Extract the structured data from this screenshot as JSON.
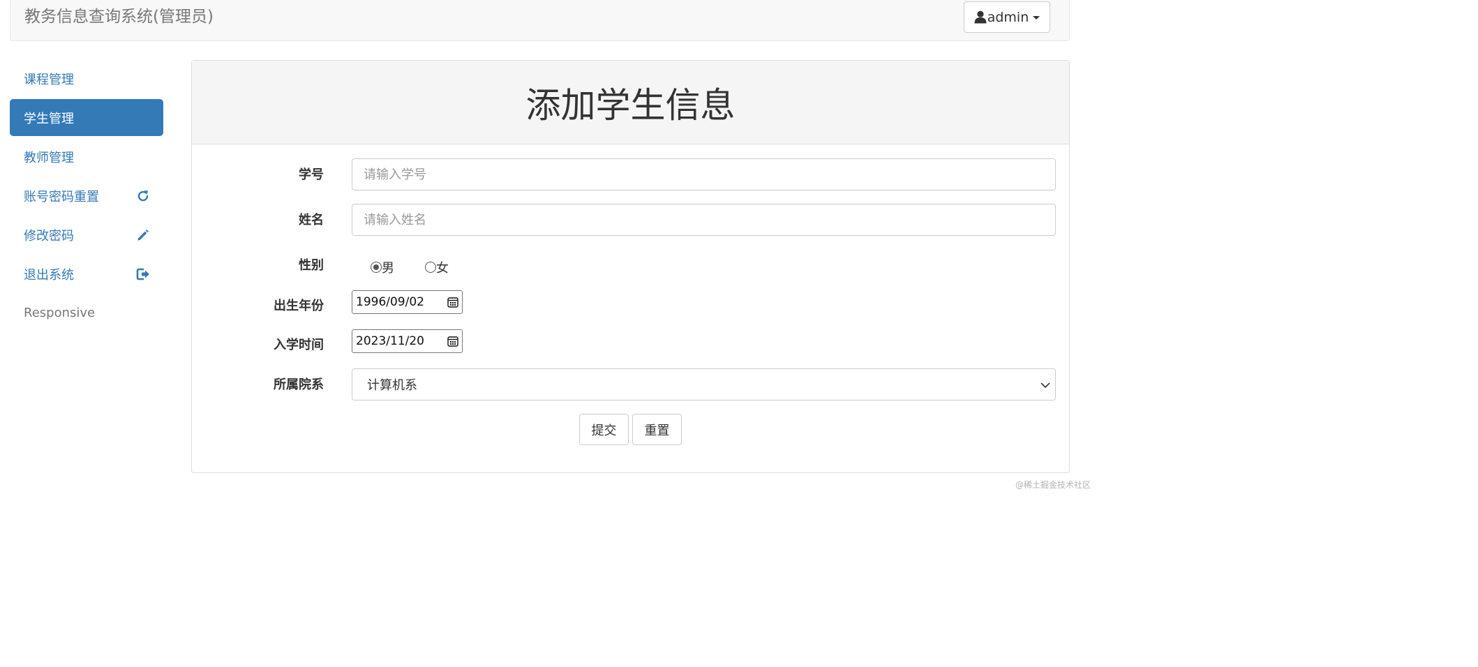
{
  "header": {
    "brand": "教务信息查询系统(管理员)",
    "user_label": "admin",
    "user_icon": "user-icon"
  },
  "sidebar": {
    "items": [
      {
        "label": "课程管理",
        "active": false
      },
      {
        "label": "学生管理",
        "active": true
      },
      {
        "label": "教师管理",
        "active": false
      },
      {
        "label": "账号密码重置",
        "icon": "refresh-icon"
      },
      {
        "label": "修改密码",
        "icon": "pencil-icon"
      },
      {
        "label": "退出系统",
        "icon": "logout-icon"
      },
      {
        "label": "Responsive"
      }
    ]
  },
  "form": {
    "title": "添加学生信息",
    "student_id": {
      "label": "学号",
      "placeholder": "请输入学号",
      "value": ""
    },
    "name": {
      "label": "姓名",
      "placeholder": "请输入姓名",
      "value": ""
    },
    "gender": {
      "label": "性别",
      "options": [
        "男",
        "女"
      ],
      "selected": "男"
    },
    "birth": {
      "label": "出生年份",
      "value": "1996/09/02"
    },
    "enroll": {
      "label": "入学时间",
      "value": "2023/11/20"
    },
    "department": {
      "label": "所属院系",
      "selected": "计算机系"
    },
    "submit_label": "提交",
    "reset_label": "重置"
  },
  "watermark": "@稀土掘金技术社区",
  "colors": {
    "primary": "#337ab7",
    "navbar_bg": "#f8f8f8",
    "panel_heading_bg": "#f5f5f5"
  }
}
